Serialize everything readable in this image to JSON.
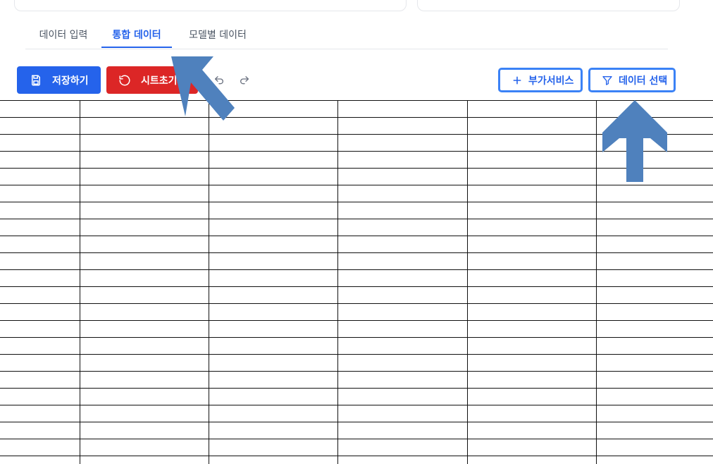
{
  "tabs": [
    {
      "label": "데이터 입력"
    },
    {
      "label": "통합 데이터",
      "active": true
    },
    {
      "label": "모델별 데이터"
    }
  ],
  "toolbar": {
    "save_label": "저장하기",
    "reset_label": "시트초기화",
    "addon_label": "부가서비스",
    "select_label": "데이터 선택"
  },
  "icons": {
    "save": "save-icon",
    "reset": "reset-icon",
    "undo": "undo-icon",
    "redo": "redo-icon",
    "plus": "plus-icon",
    "filter": "filter-icon"
  },
  "colors": {
    "primary": "#2563eb",
    "danger": "#dc2626",
    "annotation_arrow": "#4f81bd"
  },
  "sheet": {
    "columns": 6,
    "rows": 22
  }
}
